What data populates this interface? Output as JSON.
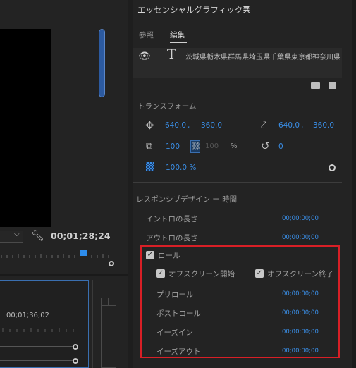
{
  "program_monitor": {
    "timecode": "00;01;28;24",
    "timeline_time": "00;01;36;02"
  },
  "essential_graphics": {
    "title": "エッセンシャルグラフィックス",
    "menu_icon": "hamburger-icon",
    "tabs": [
      {
        "label": "参照",
        "active": false
      },
      {
        "label": "編集",
        "active": true
      }
    ],
    "layer": {
      "name": "茨城県栃木県群馬県埼玉県千葉県東京都神奈川県"
    },
    "transform": {
      "section_label": "トランスフォーム",
      "position": {
        "x": "640.0",
        "sep": ",",
        "y": "360.0"
      },
      "anchor": {
        "x": "640.0",
        "sep": ",",
        "y": "360.0"
      },
      "scale": "100",
      "scale_height": "100",
      "scale_unit": "%",
      "rotation": "0",
      "opacity": "100.0 %",
      "opacity_level": 1.0
    },
    "responsive": {
      "section_label": "レスポンシブデザイン ー 時間",
      "intro_label": "イントロの長さ",
      "intro_value": "00;00;00;00",
      "outro_label": "アウトロの長さ",
      "outro_value": "00;00;00;00",
      "roll_label": "ロール",
      "roll_checked": true,
      "offscreen_start_label": "オフスクリーン開始",
      "offscreen_start_checked": true,
      "offscreen_end_label": "オフスクリーン終了",
      "offscreen_end_checked": true,
      "preroll_label": "プリロール",
      "preroll_value": "00;00;00;00",
      "postroll_label": "ポストロール",
      "postroll_value": "00;00;00;00",
      "easein_label": "イーズイン",
      "easein_value": "00;00;00;00",
      "easeout_label": "イーズアウト",
      "easeout_value": "00;00;00;00"
    },
    "highlight_color": "#d81f26",
    "accent_color": "#3a8ee6"
  }
}
